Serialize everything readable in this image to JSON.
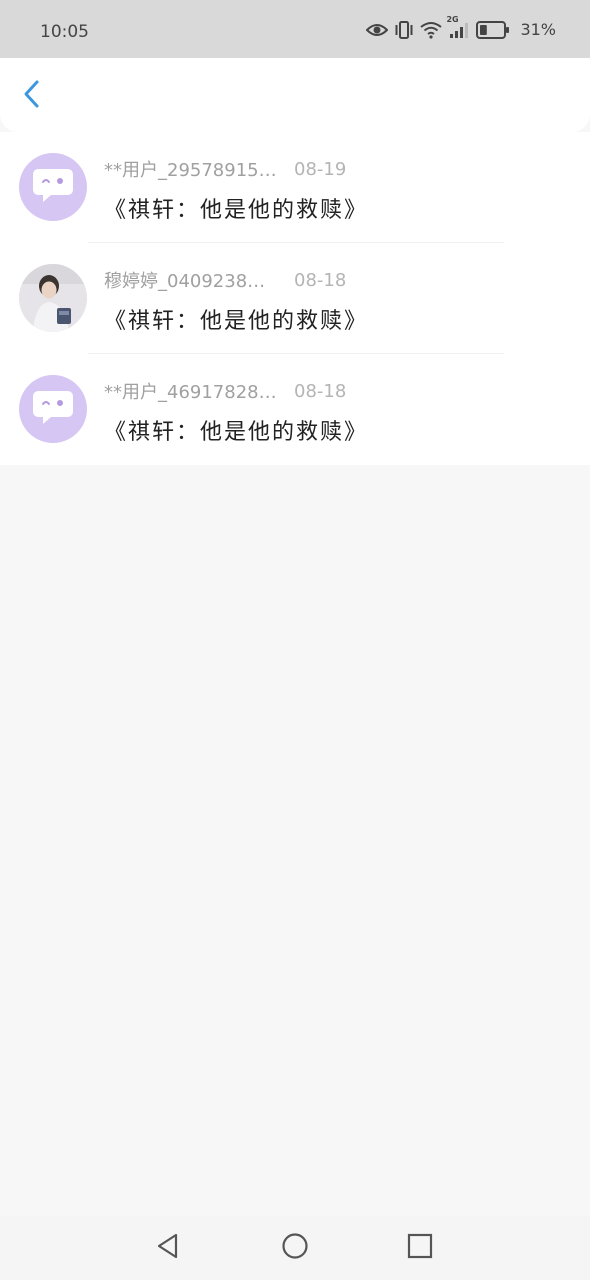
{
  "status_bar": {
    "time": "10:05",
    "network_type": "2G",
    "battery_percent": "31%",
    "battery_level": 0.31,
    "icons": [
      "eye-icon",
      "vibrate-icon",
      "wifi-icon",
      "signal-icon",
      "battery-icon"
    ]
  },
  "header": {
    "back_icon": "chevron-left-icon",
    "accent_color": "#3a97e0"
  },
  "list": {
    "items": [
      {
        "username": "**用户_29578915…",
        "date": "08-19",
        "title": "《祺轩：他是他的救赎》",
        "avatar": "default-chat-avatar"
      },
      {
        "username": "穆婷婷_0409238…",
        "date": "08-18",
        "title": "《祺轩：他是他的救赎》",
        "avatar": "photo-avatar"
      },
      {
        "username": "**用户_46917828…",
        "date": "08-18",
        "title": "《祺轩：他是他的救赎》",
        "avatar": "default-chat-avatar"
      }
    ]
  },
  "nav_bar": {
    "icons": [
      "back-triangle-icon",
      "home-circle-icon",
      "recents-square-icon"
    ]
  }
}
